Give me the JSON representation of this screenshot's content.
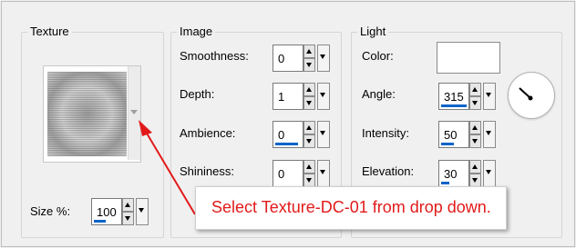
{
  "texture": {
    "legend": "Texture",
    "size_label": "Size %:",
    "size_value": "100",
    "size_fill": 0.45
  },
  "image": {
    "legend": "Image",
    "smoothness": {
      "label": "Smoothness:",
      "value": "0",
      "fill": 0
    },
    "depth": {
      "label": "Depth:",
      "value": "1",
      "fill": 0
    },
    "ambience": {
      "label": "Ambience:",
      "value": "0",
      "fill": 0.9
    },
    "shininess": {
      "label": "Shininess:",
      "value": "0",
      "fill": 0
    }
  },
  "light": {
    "legend": "Light",
    "color": {
      "label": "Color:",
      "value": "#ffffff"
    },
    "angle": {
      "label": "Angle:",
      "value": "315",
      "fill": 1.0
    },
    "intensity": {
      "label": "Intensity:",
      "value": "50",
      "fill": 0.5
    },
    "elevation": {
      "label": "Elevation:",
      "value": "30",
      "fill": 0.33
    }
  },
  "annotation": {
    "text": "Select Texture-DC-01 from drop down.",
    "color": "#e21a1a"
  },
  "icons": {
    "spin_up": "up-arrow-icon",
    "spin_down": "down-arrow-icon",
    "dropdown": "chevron-down-icon"
  }
}
